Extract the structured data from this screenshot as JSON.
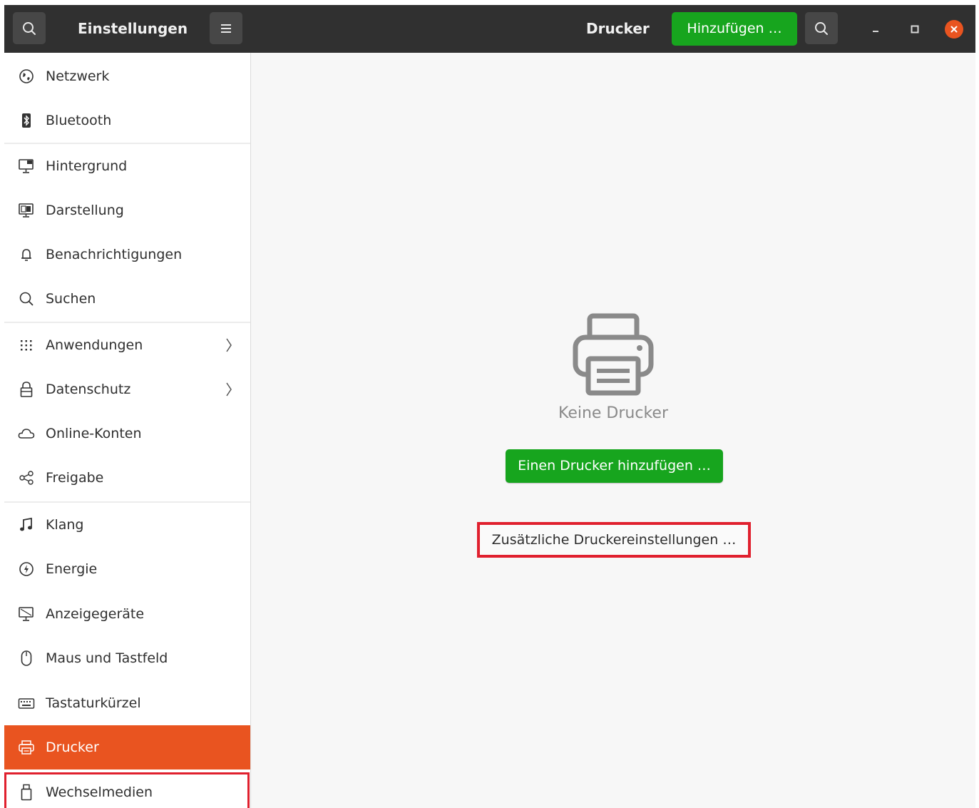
{
  "header": {
    "app_title": "Einstellungen",
    "page_title": "Drucker",
    "add_button_label": "Hinzufügen …",
    "icons": {
      "search": "search-icon",
      "menu": "hamburger-menu-icon",
      "minimize": "minimize-icon",
      "maximize": "maximize-icon",
      "close": "close-icon"
    }
  },
  "sidebar": {
    "items": [
      {
        "label": "Netzwerk",
        "icon": "network-globe-icon"
      },
      {
        "label": "Bluetooth",
        "icon": "bluetooth-icon"
      },
      {
        "label": "Hintergrund",
        "icon": "background-monitor-icon"
      },
      {
        "label": "Darstellung",
        "icon": "appearance-icon"
      },
      {
        "label": "Benachrichtigungen",
        "icon": "bell-icon"
      },
      {
        "label": "Suchen",
        "icon": "search-icon"
      },
      {
        "label": "Anwendungen",
        "icon": "apps-grid-icon",
        "has_submenu": true
      },
      {
        "label": "Datenschutz",
        "icon": "lock-icon",
        "has_submenu": true
      },
      {
        "label": "Online-Konten",
        "icon": "cloud-icon"
      },
      {
        "label": "Freigabe",
        "icon": "share-icon"
      },
      {
        "label": "Klang",
        "icon": "music-note-icon"
      },
      {
        "label": "Energie",
        "icon": "power-icon"
      },
      {
        "label": "Anzeigegeräte",
        "icon": "display-icon"
      },
      {
        "label": "Maus und Tastfeld",
        "icon": "mouse-icon"
      },
      {
        "label": "Tastaturkürzel",
        "icon": "keyboard-icon"
      },
      {
        "label": "Drucker",
        "icon": "printer-icon",
        "active": true
      },
      {
        "label": "Wechselmedien",
        "icon": "removable-media-icon"
      }
    ]
  },
  "main": {
    "empty_icon": "printer-icon",
    "empty_label": "Keine Drucker",
    "add_printer_button": "Einen Drucker hinzufügen …",
    "extra_settings_button": "Zusätzliche Druckereinstellungen …"
  },
  "colors": {
    "headerbar": "#303030",
    "accent_green": "#17a51e",
    "active_orange": "#e95420",
    "highlight_red": "#e0202e"
  }
}
